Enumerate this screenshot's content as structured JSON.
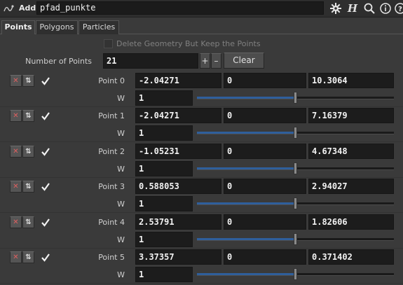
{
  "header": {
    "node_type": "Add",
    "node_name": "pfad_punkte",
    "icons": [
      "node-add-icon",
      "gear-icon",
      "houdini-h-icon",
      "search-icon",
      "info-icon",
      "help-icon"
    ]
  },
  "tabs": [
    {
      "label": "Points",
      "active": true
    },
    {
      "label": "Polygons",
      "active": false
    },
    {
      "label": "Particles",
      "active": false
    }
  ],
  "delete_geometry": {
    "label": "Delete Geometry But Keep the Points",
    "checked": false
  },
  "number_of_points": {
    "label": "Number of Points",
    "value": "21",
    "plus": "+",
    "minus": "–",
    "clear": "Clear"
  },
  "w_label": "W",
  "points": [
    {
      "label": "Point 0",
      "x": "-2.04271",
      "y": "0",
      "z": "10.3064",
      "w": "1",
      "w_level": 1.0,
      "enabled": true
    },
    {
      "label": "Point 1",
      "x": "-2.04271",
      "y": "0",
      "z": "7.16379",
      "w": "1",
      "w_level": 1.0,
      "enabled": true
    },
    {
      "label": "Point 2",
      "x": "-1.05231",
      "y": "0",
      "z": "4.67348",
      "w": "1",
      "w_level": 1.0,
      "enabled": true
    },
    {
      "label": "Point 3",
      "x": "0.588053",
      "y": "0",
      "z": "2.94027",
      "w": "1",
      "w_level": 1.0,
      "enabled": true
    },
    {
      "label": "Point 4",
      "x": "2.53791",
      "y": "0",
      "z": "1.82606",
      "w": "1",
      "w_level": 1.0,
      "enabled": true
    },
    {
      "label": "Point 5",
      "x": "3.37357",
      "y": "0",
      "z": "0.371402",
      "w": "1",
      "w_level": 1.0,
      "enabled": true
    }
  ],
  "colors": {
    "slider_fill": "#2f5f9c",
    "delete_button": "#e06060"
  }
}
